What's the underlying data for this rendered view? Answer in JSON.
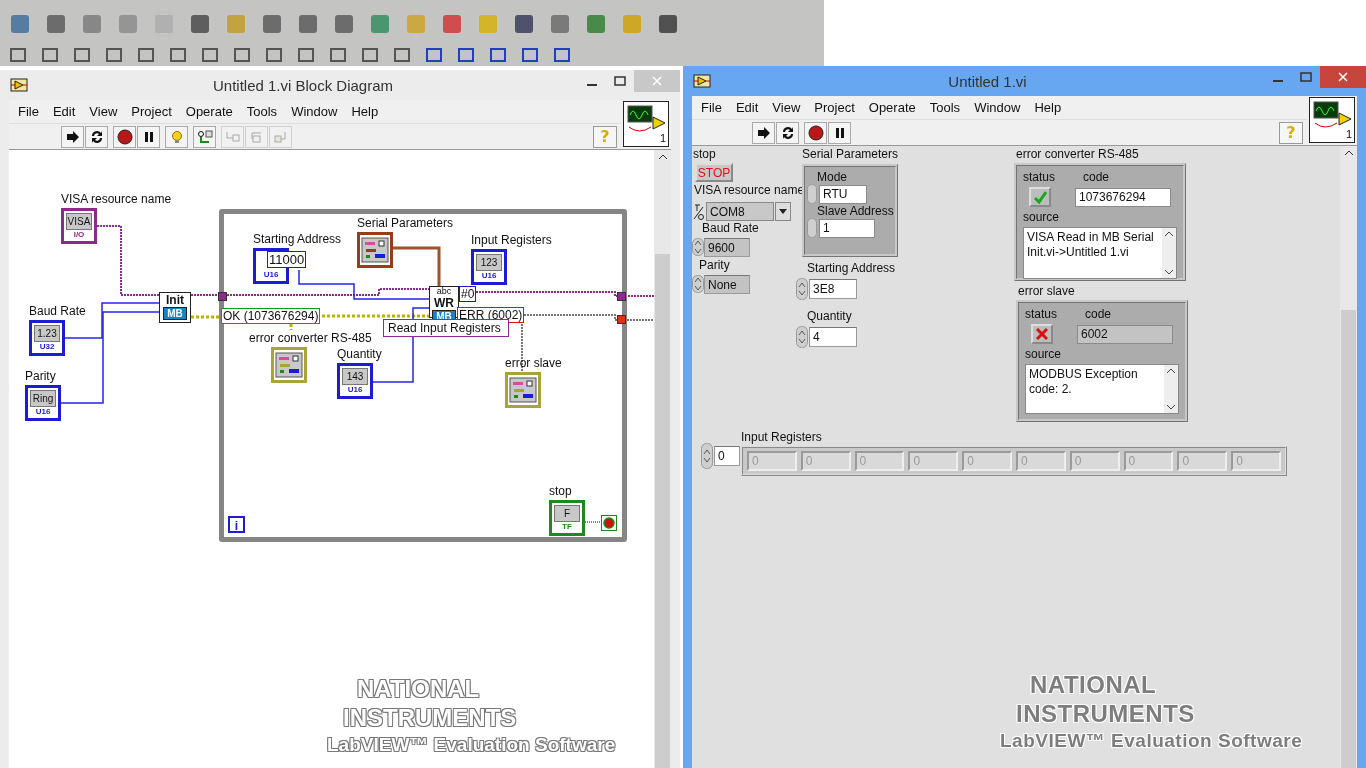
{
  "diagram_window": {
    "title": "Untitled 1.vi Block Diagram",
    "active": false,
    "menu": [
      "File",
      "Edit",
      "View",
      "Project",
      "Operate",
      "Tools",
      "Window",
      "Help"
    ],
    "toolbar": [
      {
        "kind": "run",
        "disabled": false
      },
      {
        "kind": "run_continuously",
        "disabled": false
      },
      {
        "kind": "abort",
        "disabled": false
      },
      {
        "kind": "pause",
        "disabled": false
      },
      {
        "kind": "highlight",
        "disabled": false
      },
      {
        "kind": "retain",
        "disabled": false
      },
      {
        "kind": "step_into",
        "disabled": true
      },
      {
        "kind": "step_over",
        "disabled": true
      },
      {
        "kind": "step_out",
        "disabled": true
      }
    ],
    "help_button": "?",
    "vi_icon_number": "1",
    "terminals": [
      {
        "label": "VISA resource name",
        "kind": "visa",
        "glyph": "VISA",
        "tag": "I/O",
        "color": "#8e2a8e"
      },
      {
        "label": "Baud Rate",
        "kind": "numeric",
        "glyph": "1.23",
        "tag": "U32",
        "color": "#1c1cd6"
      },
      {
        "label": "Parity",
        "kind": "ring",
        "glyph": "Ring",
        "tag": "U16",
        "color": "#1c1cd6"
      },
      {
        "label": "Starting Address",
        "kind": "numeric",
        "glyph": "11000",
        "tag": "U16",
        "color": "#1c1cd6"
      },
      {
        "label": "Serial Parameters",
        "kind": "cluster",
        "color": "#9a3c18"
      },
      {
        "label": "Input Registers",
        "kind": "array",
        "glyph": "123",
        "tag": "U16",
        "color": "#1c1cd6"
      },
      {
        "label": "error converter RS-485",
        "kind": "cluster",
        "color": "#a8a43a"
      },
      {
        "label": "Quantity",
        "kind": "numeric",
        "glyph": "143",
        "tag": "U16",
        "color": "#1c1cd6"
      },
      {
        "label": "error slave",
        "kind": "cluster",
        "color": "#a8a43a"
      },
      {
        "label": "stop",
        "kind": "boolean",
        "glyph": "F",
        "tag": "TF",
        "color": "#1e8a1e"
      }
    ],
    "init_node": {
      "title": "Init",
      "badge": "MB"
    },
    "write_node": {
      "top": "abc",
      "title": "WR",
      "badge": "MB",
      "index": "#0"
    },
    "probes": [
      {
        "text": "OK (1073676294)",
        "color": "#1a9a1a"
      },
      {
        "text": "ERR (6002)",
        "color": "#e01010"
      }
    ],
    "function_selector": "Read Input Registers",
    "loop_index": "i",
    "watermark": [
      "NATIONAL",
      "INSTRUMENTS",
      "LabVIEW™ Evaluation Software"
    ]
  },
  "panel_window": {
    "title": "Untitled 1.vi",
    "active": true,
    "menu": [
      "File",
      "Edit",
      "View",
      "Project",
      "Operate",
      "Tools",
      "Window",
      "Help"
    ],
    "toolbar": [
      {
        "kind": "run",
        "disabled": false
      },
      {
        "kind": "run_continuously",
        "disabled": false
      },
      {
        "kind": "abort",
        "disabled": false
      },
      {
        "kind": "pause",
        "disabled": false
      }
    ],
    "help_button": "?",
    "vi_icon_number": "1",
    "stop": {
      "label": "stop",
      "text": "STOP"
    },
    "visa": {
      "label": "VISA resource name",
      "value": "COM8"
    },
    "baud_rate": {
      "label": "Baud Rate",
      "value": "9600"
    },
    "parity": {
      "label": "Parity",
      "value": "None"
    },
    "serial_parameters": {
      "label": "Serial Parameters",
      "mode_label": "Mode",
      "mode": "RTU",
      "slave_label": "Slave Address",
      "slave_address": "1"
    },
    "starting_address": {
      "label": "Starting Address",
      "value": "3E8"
    },
    "quantity": {
      "label": "Quantity",
      "value": "4"
    },
    "errors": [
      {
        "label": "error converter RS-485",
        "status_label": "status",
        "status": true,
        "code_label": "code",
        "code": "1073676294",
        "source_label": "source",
        "source": "VISA Read in MB Serial Init.vi->Untitled 1.vi"
      },
      {
        "label": "error slave",
        "status_label": "status",
        "status": false,
        "code_label": "code",
        "code": "6002",
        "source_label": "source",
        "source": "MODBUS Exception code: 2."
      }
    ],
    "input_registers": {
      "label": "Input Registers",
      "index": "0",
      "values": [
        "0",
        "0",
        "0",
        "0",
        "0",
        "0",
        "0",
        "0",
        "0",
        "0"
      ]
    },
    "watermark": [
      "NATIONAL",
      "INSTRUMENTS",
      "LabVIEW™ Evaluation Software"
    ]
  }
}
